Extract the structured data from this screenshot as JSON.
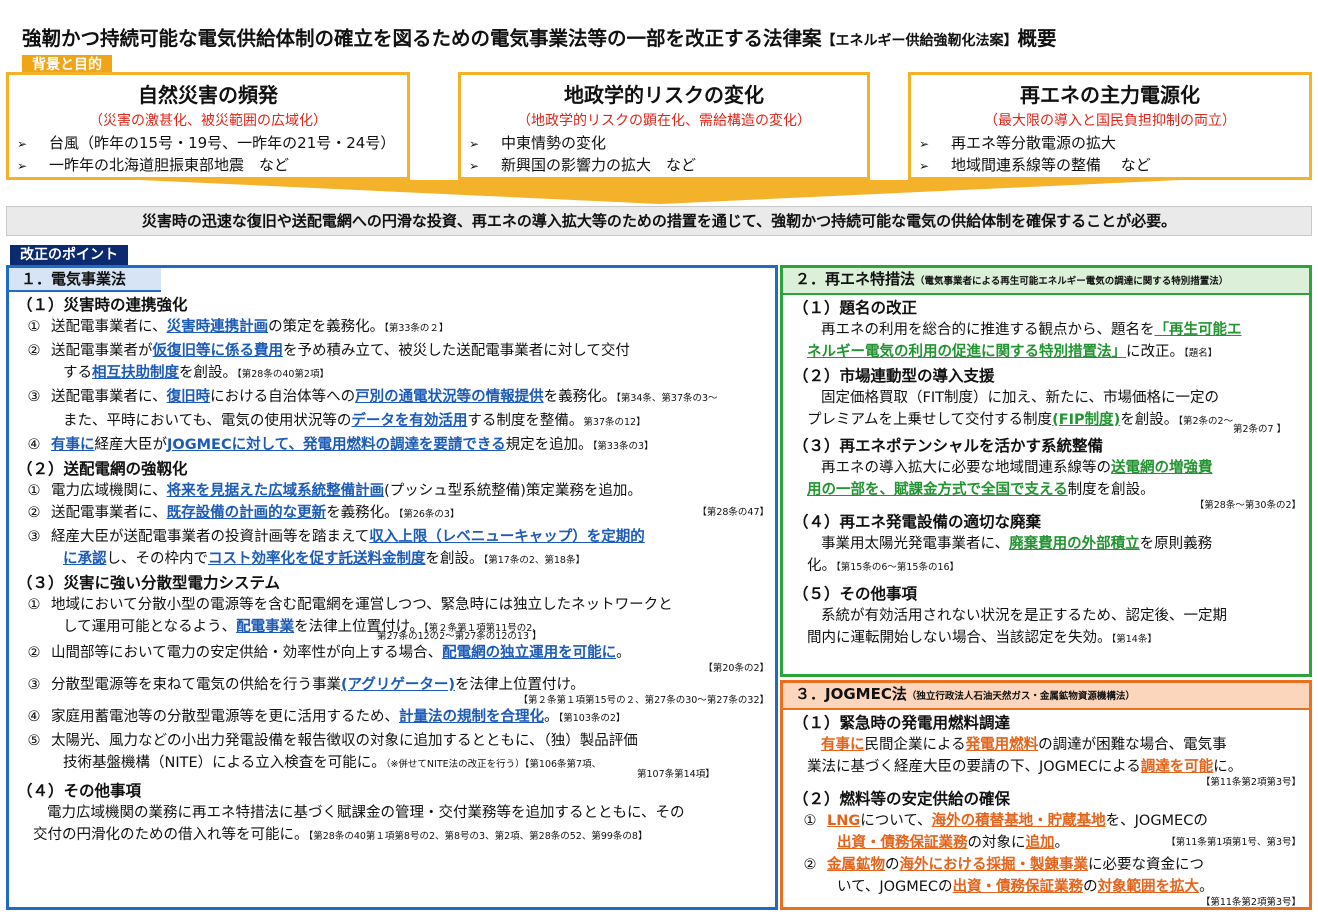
{
  "title": {
    "main": "強靭かつ持続可能な電気供給体制の確立を図るための電気事業法等の一部を改正する法律案",
    "sub": "【エネルギー供給強靭化法案】",
    "tail": "概要"
  },
  "tag_background": "背景と目的",
  "background": [
    {
      "heading": "自然災害の頻発",
      "sub": "（災害の激甚化、被災範囲の広域化）",
      "items": [
        "台風（昨年の15号・19号、一昨年の21号・24号）",
        "一昨年の北海道胆振東部地震　など"
      ]
    },
    {
      "heading": "地政学的リスクの変化",
      "sub": "（地政学的リスクの顕在化、需給構造の変化）",
      "items": [
        "中東情勢の変化",
        "新興国の影響力の拡大　など"
      ]
    },
    {
      "heading": "再エネの主力電源化",
      "sub": "（最大限の導入と国民負担抑制の両立）",
      "items": [
        "再エネ等分散電源の拡大",
        "地域間連系線等の整備　 など"
      ]
    }
  ],
  "need": "災害時の迅速な復旧や送配電網への円滑な投資、再エネの導入拡大等のための措置を通じて、強靭かつ持続可能な電気の供給体制を確保することが必要。",
  "tag_points": "改正のポイント",
  "p1": {
    "head": "１．電気事業法",
    "s1": "（１）災害時の連携強化",
    "s1_1": {
      "n": "①",
      "a": "送配電事業者に、",
      "b": "災害時連携計画",
      "c": "の策定を義務化。",
      "r": "【第33条の２】"
    },
    "s1_2": {
      "n": "②",
      "a": "送配電事業者が",
      "b": "仮復旧等に係る費用",
      "c": "を予め積み立て、被災した送配電事業者に対して交付",
      "d": "する",
      "e": "相互扶助制度",
      "f": "を創設。",
      "r": "【第28条の40第2項】"
    },
    "s1_3": {
      "n": "③",
      "a": "送配電事業者に、",
      "b": "復旧時",
      "c": "における自治体等への",
      "d": "戸別の通電状況等の情報提供",
      "e": "を義務化。",
      "f": "また、平時においても、電気の使用状況等の",
      "g": "データを有効活用",
      "h": "する制度を整備。",
      "r1": "【第34条、第37条の3～",
      "r2": "第37条の12】"
    },
    "s1_4": {
      "n": "④",
      "a": "有事に",
      "b": "経産大臣が",
      "c": "JOGMECに対して、発電用燃料の調達を要請できる",
      "d": "規定を追加。",
      "r": "【第33条の3】"
    },
    "s2": "（２）送配電網の強靱化",
    "s2_1": {
      "n": "①",
      "a": "電力広域機関に、",
      "b": "将来を見据えた広域系統整備計画",
      "c": "(プッシュ型系統整備)策定業務を追加。",
      "r": "【第28条の47】"
    },
    "s2_2": {
      "n": "②",
      "a": "送配電事業者に、",
      "b": "既存設備の計画的な更新",
      "c": "を義務化。",
      "r": "【第26条の3】"
    },
    "s2_3": {
      "n": "③",
      "a": "経産大臣が送配電事業者の投資計画等を踏まえて",
      "b": "収入上限（レベニューキャップ）を定期的",
      "c": "に承認",
      "d": "し、その枠内で",
      "e": "コスト効率化を促す託送料金制度",
      "f": "を創設。",
      "r": "【第17条の2、第18条】"
    },
    "s3": "（３）災害に強い分散型電力システム",
    "s3_1": {
      "n": "①",
      "a": "地域において分散小型の電源等を含む配電網を運営しつつ、緊急時には独立したネットワークと",
      "b": "して運用可能となるよう、",
      "c": "配電事業",
      "d": "を法律上位置付け。",
      "r1": "【第２条第１項第11号の2、",
      "r2": "第27条の12の2～第27条の12の13 】"
    },
    "s3_2": {
      "n": "②",
      "a": "山間部等において電力の安定供給・効率性が向上する場合、",
      "b": "配電網の独立運用を可能に",
      "c": "。",
      "r": "【第20条の2】"
    },
    "s3_3": {
      "n": "③",
      "a": "分散型電源等を束ねて電気の供給を行う事業",
      "b": "(アグリゲーター)",
      "c": "を法律上位置付け。",
      "r": "【第２条第１項第15号の２、第27条の30～第27条の32】"
    },
    "s3_4": {
      "n": "④",
      "a": "家庭用蓄電池等の分散型電源等を更に活用するため、",
      "b": "計量法の規制を合理化",
      "c": "。",
      "r": "【第103条の2】"
    },
    "s3_5": {
      "n": "⑤",
      "a": "太陽光、風力などの小出力発電設備を報告徴収の対象に追加するとともに、（独）製品評価",
      "b": "技術基盤機構（NITE）による立入検査を可能に。",
      "c": "（※併せてNITE法の改正を行う）",
      "r1": "【第106条第7項、",
      "r2": "第107条第14項】"
    },
    "s4": "（４）その他事項",
    "s4_1": {
      "a": "電力広域機関の業務に再エネ特措法に基づく賦課金の管理・交付業務等を追加するとともに、その",
      "b": "交付の円滑化のための借入れ等を可能に。",
      "r": "【第28条の40第１項第8号の2、第8号の3、第2項、第28条の52、第99条の8】"
    }
  },
  "p2": {
    "head": "２．再エネ特措法",
    "head_sub": "（電気事業者による再生可能エネルギー電気の調達に関する特別措置法）",
    "s1": "（１）題名の改正",
    "s1_t": {
      "a": "再エネの利用を総合的に推進する観点から、題名を",
      "b": "「再生可能エ",
      "c": "ネルギー電気の利用の促進に関する特別措置法」",
      "d": "に改正。",
      "r": "【題名】"
    },
    "s2": "（２）市場連動型の導入支援",
    "s2_t": {
      "a": "固定価格買取（FIT制度）に加え、新たに、市場価格に一定の",
      "b": "プレミアムを上乗せして交付する制度",
      "c": "(FIP制度)",
      "d": "を創設。",
      "r1": "【第2条の2～",
      "r2": "第2条の7 】"
    },
    "s3": "（３）再エネポテンシャルを活かす系統整備",
    "s3_t": {
      "a": "再エネの導入拡大に必要な地域間連系線等の",
      "b": "送電網の増強費",
      "c": "用の一部を、賦課金方式で全国で支える",
      "d": "制度を創設。",
      "r": "【第28条～第30条の2】"
    },
    "s4": "（４）再エネ発電設備の適切な廃棄",
    "s4_t": {
      "a": "事業用太陽光発電事業者に、",
      "b": "廃棄費用の外部積立",
      "c": "を原則義務",
      "d": "化。",
      "r": "【第15条の6～第15条の16】"
    },
    "s5": "（５）その他事項",
    "s5_t": {
      "a": "系統が有効活用されない状況を是正するため、認定後、一定期",
      "b": "間内に運転開始しない場合、当該認定を失効。",
      "r": "【第14条】"
    }
  },
  "p3": {
    "head": "３．JOGMEC法",
    "head_sub": "（独立行政法人石油天然ガス・金属鉱物資源機構法）",
    "s1": "（１）緊急時の発電用燃料調達",
    "s1_t": {
      "a": "有事に",
      "b": "民間企業による",
      "c": "発電用燃料",
      "d": "の調達が困難な場合、電気事",
      "e": "業法に基づく経産大臣の要請の下、JOGMECによる",
      "f": "調達を可能",
      "g": "に。",
      "r": "【第11条第2項第3号】"
    },
    "s2": "（２）燃料等の安定供給の確保",
    "s2_1": {
      "n": "①",
      "a": "LNG",
      "b": "について、",
      "c": "海外の積替基地・貯蔵基地",
      "d": "を、JOGMECの",
      "e": "出資・債務保証業務",
      "f": "の対象に",
      "g": "追加",
      "h": "。",
      "r": "【第11条第1項第1号、第3号】"
    },
    "s2_2": {
      "n": "②",
      "a": "金属鉱物",
      "b": "の",
      "c": "海外における採掘・製錬事業",
      "d": "に必要な資金につ",
      "e": "いて、JOGMECの",
      "f": "出資・債務保証業務",
      "g": "の",
      "h": "対象範囲を拡大",
      "i": "。",
      "r": "【第11条第2項第3号】"
    }
  },
  "colors": {
    "orange": "#f4b12a",
    "blue": "#1f6cc6",
    "green": "#2da33b",
    "deep_orange": "#e9701e",
    "navy": "#0b2a6f",
    "red": "#e0261b"
  }
}
